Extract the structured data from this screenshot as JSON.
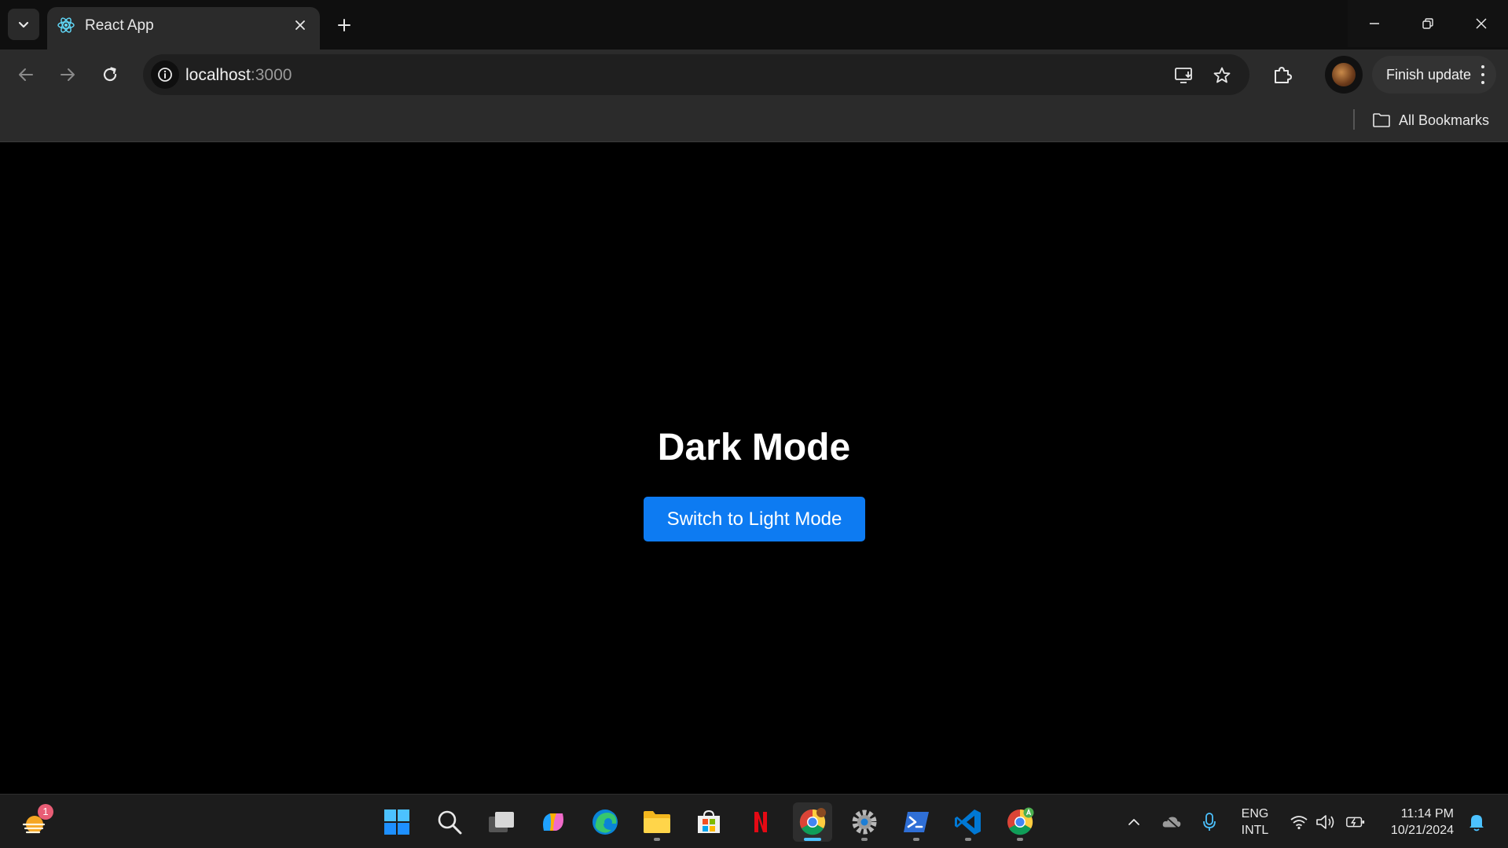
{
  "browser": {
    "tab": {
      "title": "React App",
      "icon": "react-icon"
    },
    "address": {
      "host": "localhost",
      "port": ":3000"
    },
    "profile_button": {
      "label": "Finish update"
    },
    "bookmarks": {
      "all_label": "All Bookmarks"
    }
  },
  "page": {
    "heading": "Dark Mode",
    "toggle_button_label": "Switch to Light Mode",
    "background": "#000000",
    "button_color": "#0d7bf2"
  },
  "taskbar": {
    "weather_badge": "1",
    "apps": [
      "windows-start",
      "search",
      "task-view",
      "copilot",
      "edge",
      "file-explorer",
      "microsoft-store",
      "netflix",
      "chrome",
      "settings",
      "terminal",
      "vscode",
      "chrome-profile"
    ],
    "language": {
      "line1": "ENG",
      "line2": "INTL"
    },
    "time": "11:14 PM",
    "date": "10/21/2024"
  }
}
